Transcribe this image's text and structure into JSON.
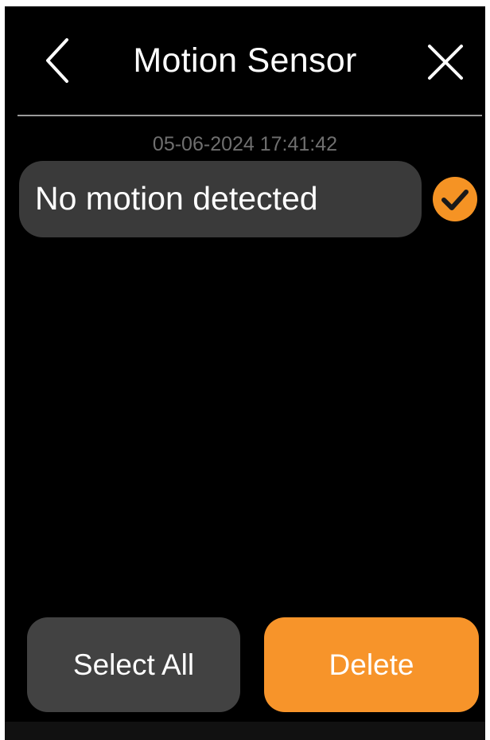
{
  "header": {
    "title": "Motion Sensor",
    "back_icon": "chevron-left-icon",
    "close_icon": "close-icon"
  },
  "event": {
    "timestamp": "05-06-2024 17:41:42",
    "message": "No motion detected",
    "selected": true,
    "check_icon": "checkmark-circle-icon"
  },
  "actions": {
    "select_all_label": "Select All",
    "delete_label": "Delete"
  },
  "colors": {
    "background": "#000000",
    "accent": "#f7942a",
    "bubble": "#3a3a3a",
    "secondary_button": "#424242",
    "timestamp_text": "#6f6f6f"
  }
}
